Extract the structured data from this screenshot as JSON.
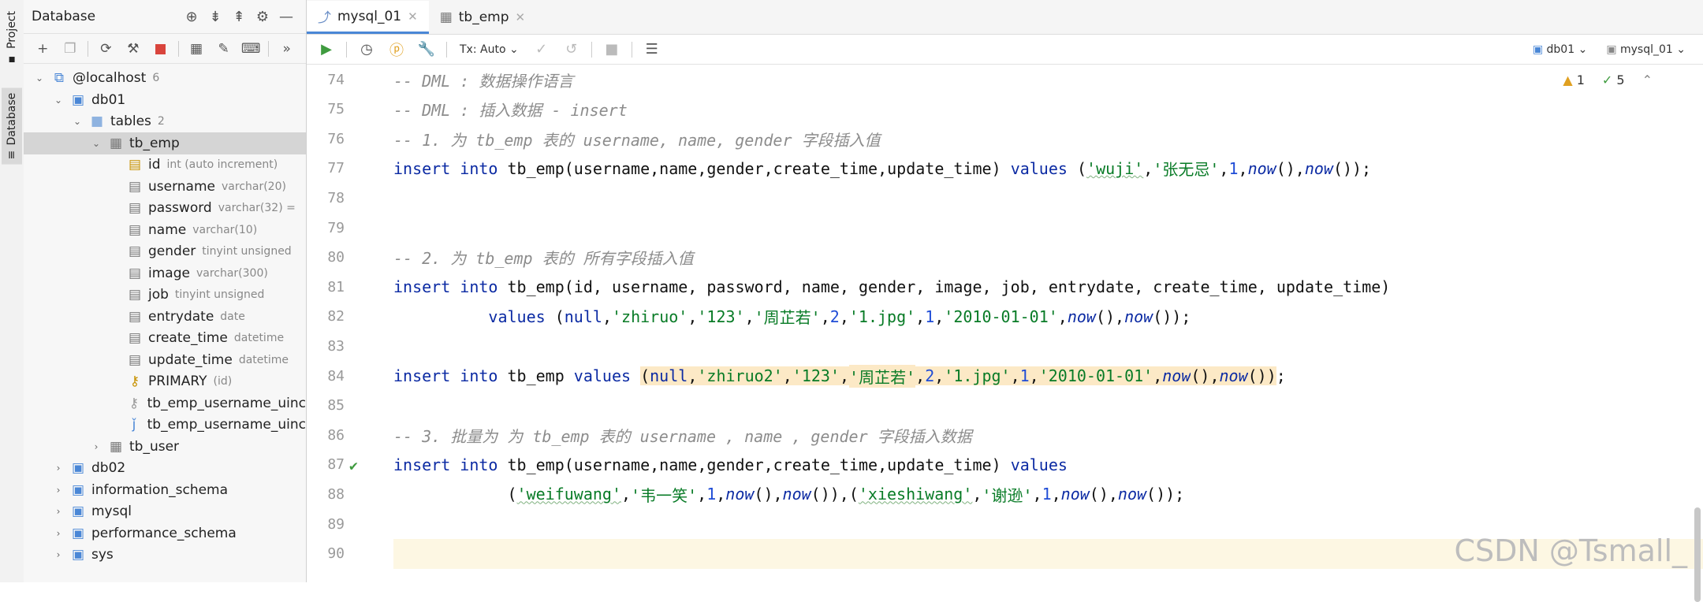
{
  "stripe": {
    "project_label": "Project",
    "database_label": "Database"
  },
  "sidebar": {
    "title": "Database",
    "tree": [
      {
        "level": 0,
        "label": "@localhost",
        "badge": "6",
        "expanded": true,
        "type": "host"
      },
      {
        "level": 1,
        "label": "db01",
        "expanded": true,
        "type": "schema"
      },
      {
        "level": 2,
        "label": "tables",
        "badge": "2",
        "expanded": true,
        "type": "folder"
      },
      {
        "level": 3,
        "label": "tb_emp",
        "expanded": true,
        "type": "table",
        "selected": true
      },
      {
        "level": 4,
        "label": "id",
        "dim": "int (auto increment)",
        "type": "key-col"
      },
      {
        "level": 4,
        "label": "username",
        "dim": "varchar(20)",
        "type": "col"
      },
      {
        "level": 4,
        "label": "password",
        "dim": "varchar(32) =",
        "type": "col"
      },
      {
        "level": 4,
        "label": "name",
        "dim": "varchar(10)",
        "type": "col"
      },
      {
        "level": 4,
        "label": "gender",
        "dim": "tinyint unsigned",
        "type": "col"
      },
      {
        "level": 4,
        "label": "image",
        "dim": "varchar(300)",
        "type": "col"
      },
      {
        "level": 4,
        "label": "job",
        "dim": "tinyint unsigned",
        "type": "col"
      },
      {
        "level": 4,
        "label": "entrydate",
        "dim": "date",
        "type": "col"
      },
      {
        "level": 4,
        "label": "create_time",
        "dim": "datetime",
        "type": "col"
      },
      {
        "level": 4,
        "label": "update_time",
        "dim": "datetime",
        "type": "col"
      },
      {
        "level": 4,
        "label": "PRIMARY",
        "dim": "(id)",
        "type": "pk"
      },
      {
        "level": 4,
        "label": "tb_emp_username_uinc",
        "type": "key"
      },
      {
        "level": 4,
        "label": "tb_emp_username_uinc",
        "type": "index"
      },
      {
        "level": 3,
        "label": "tb_user",
        "expanded": false,
        "type": "table"
      },
      {
        "level": 1,
        "label": "db02",
        "expanded": false,
        "type": "schema"
      },
      {
        "level": 1,
        "label": "information_schema",
        "expanded": false,
        "type": "schema"
      },
      {
        "level": 1,
        "label": "mysql",
        "expanded": false,
        "type": "schema"
      },
      {
        "level": 1,
        "label": "performance_schema",
        "expanded": false,
        "type": "schema"
      },
      {
        "level": 1,
        "label": "sys",
        "expanded": false,
        "type": "schema"
      }
    ]
  },
  "tabs": [
    {
      "label": "mysql_01",
      "active": true
    },
    {
      "label": "tb_emp",
      "active": false
    }
  ],
  "toolbar": {
    "tx_mode": "Tx: Auto",
    "schema": "db01",
    "datasource": "mysql_01"
  },
  "inspections": {
    "warnings": "1",
    "ok": "5"
  },
  "editor": {
    "lines": [
      {
        "num": "74",
        "tokens": [
          [
            "cm",
            "-- DML : 数据操作语言"
          ]
        ]
      },
      {
        "num": "75",
        "tokens": [
          [
            "cm",
            "-- DML : 插入数据 - insert"
          ]
        ]
      },
      {
        "num": "76",
        "tokens": [
          [
            "cm",
            "-- 1. 为 tb_emp 表的 username, name, gender 字段插入值"
          ]
        ]
      },
      {
        "num": "77",
        "tokens": [
          [
            "kw",
            "insert into "
          ],
          [
            "",
            "tb_emp(username,name,gender,create_time,update_time) "
          ],
          [
            "kw",
            "values "
          ],
          [
            "",
            "("
          ],
          [
            "str sq",
            "'wuji'"
          ],
          [
            "",
            ","
          ],
          [
            "str",
            "'张无忌'"
          ],
          [
            "",
            ","
          ],
          [
            "num",
            "1"
          ],
          [
            "",
            ","
          ],
          [
            "fn",
            "now"
          ],
          [
            "",
            "(),"
          ],
          [
            "fn",
            "now"
          ],
          [
            "",
            "());"
          ]
        ]
      },
      {
        "num": "78",
        "tokens": []
      },
      {
        "num": "79",
        "tokens": []
      },
      {
        "num": "80",
        "tokens": [
          [
            "cm",
            "-- 2. 为 tb_emp 表的 所有字段插入值"
          ]
        ]
      },
      {
        "num": "81",
        "tokens": [
          [
            "kw",
            "insert into "
          ],
          [
            "",
            "tb_emp(id, username, password, name, gender, image, job, entrydate, create_time, update_time)"
          ]
        ]
      },
      {
        "num": "82",
        "tokens": [
          [
            "",
            "          "
          ],
          [
            "kw",
            "values "
          ],
          [
            "",
            "("
          ],
          [
            "kw",
            "null"
          ],
          [
            "",
            ","
          ],
          [
            "str",
            "'zhiruo'"
          ],
          [
            "",
            ","
          ],
          [
            "str",
            "'123'"
          ],
          [
            "",
            ","
          ],
          [
            "str",
            "'周芷若'"
          ],
          [
            "",
            ","
          ],
          [
            "num",
            "2"
          ],
          [
            "",
            ","
          ],
          [
            "str",
            "'1.jpg'"
          ],
          [
            "",
            ","
          ],
          [
            "num",
            "1"
          ],
          [
            "",
            ","
          ],
          [
            "str",
            "'2010-01-01'"
          ],
          [
            "",
            ","
          ],
          [
            "fn",
            "now"
          ],
          [
            "",
            "(),"
          ],
          [
            "fn",
            "now"
          ],
          [
            "",
            "());"
          ]
        ]
      },
      {
        "num": "83",
        "tokens": []
      },
      {
        "num": "84",
        "tokens": [
          [
            "kw",
            "insert into "
          ],
          [
            "",
            "tb_emp "
          ],
          [
            "kw",
            "values "
          ],
          [
            "hl",
            "("
          ],
          [
            "hl kw",
            "null"
          ],
          [
            "hl",
            ","
          ],
          [
            "hl str",
            "'zhiruo2'"
          ],
          [
            "hl",
            ","
          ],
          [
            "hl str",
            "'123'"
          ],
          [
            "hl",
            ","
          ],
          [
            "hl str",
            "'周芷若'"
          ],
          [
            "hl",
            ","
          ],
          [
            "hl num",
            "2"
          ],
          [
            "hl",
            ","
          ],
          [
            "hl str",
            "'1.jpg'"
          ],
          [
            "hl",
            ","
          ],
          [
            "hl num",
            "1"
          ],
          [
            "hl",
            ","
          ],
          [
            "hl str",
            "'2010-01-01'"
          ],
          [
            "hl",
            ","
          ],
          [
            "hl fn",
            "now"
          ],
          [
            "hl",
            "(),"
          ],
          [
            "hl fn",
            "now"
          ],
          [
            "hl",
            "())"
          ],
          [
            "",
            ";"
          ]
        ]
      },
      {
        "num": "85",
        "tokens": []
      },
      {
        "num": "86",
        "tokens": [
          [
            "cm",
            "-- 3. 批量为 为 tb_emp 表的 username , name , gender 字段插入数据"
          ]
        ]
      },
      {
        "num": "87",
        "tokens": [
          [
            "kw",
            "insert into "
          ],
          [
            "",
            "tb_emp(username,name,gender,create_time,update_time) "
          ],
          [
            "kw",
            "values"
          ]
        ]
      },
      {
        "num": "88",
        "tokens": [
          [
            "",
            "            ("
          ],
          [
            "str sq",
            "'weifuwang'"
          ],
          [
            "",
            ","
          ],
          [
            "str",
            "'韦一笑'"
          ],
          [
            "",
            ","
          ],
          [
            "num",
            "1"
          ],
          [
            "",
            ","
          ],
          [
            "fn",
            "now"
          ],
          [
            "",
            "(),"
          ],
          [
            "fn",
            "now"
          ],
          [
            "",
            "()),("
          ],
          [
            "str sq",
            "'xieshiwang'"
          ],
          [
            "",
            ","
          ],
          [
            "str",
            "'谢逊'"
          ],
          [
            "",
            ","
          ],
          [
            "num",
            "1"
          ],
          [
            "",
            ","
          ],
          [
            "fn",
            "now"
          ],
          [
            "",
            "(),"
          ],
          [
            "fn",
            "now"
          ],
          [
            "",
            "());"
          ]
        ]
      },
      {
        "num": "89",
        "tokens": []
      },
      {
        "num": "90",
        "tokens": [],
        "current": true
      }
    ]
  },
  "watermark": "CSDN @Tsmall_"
}
